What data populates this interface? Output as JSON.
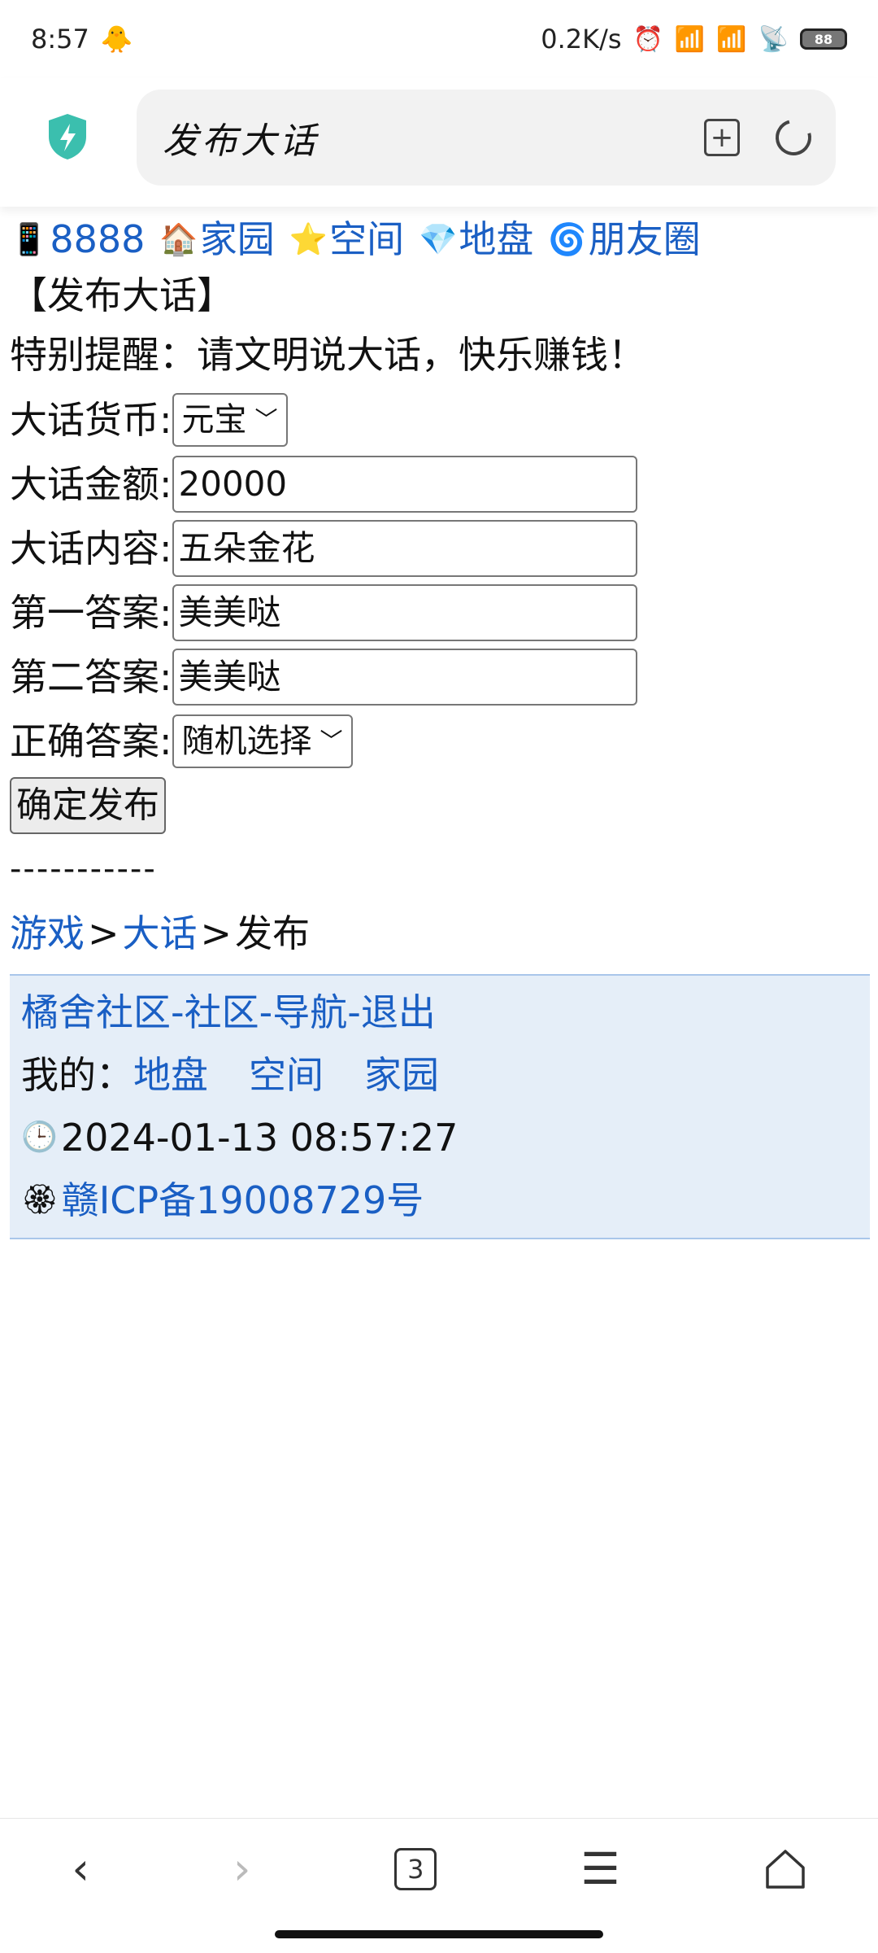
{
  "status_bar": {
    "time": "8:57",
    "network_speed": "0.2K/s",
    "battery": "88"
  },
  "browser": {
    "url_title": "发布大话"
  },
  "nav": {
    "items": [
      {
        "icon": "phone-icon",
        "label": "8888"
      },
      {
        "icon": "house-icon",
        "label": "家园"
      },
      {
        "icon": "star-icon",
        "label": "空间"
      },
      {
        "icon": "gem-icon",
        "label": "地盘"
      },
      {
        "icon": "aperture-icon",
        "label": "朋友圈"
      }
    ]
  },
  "page": {
    "heading": "【发布大话】",
    "notice": "特别提醒：请文明说大话，快乐赚钱！",
    "currency_label": "大话货币:",
    "currency_value": "元宝",
    "amount_label": "大话金额:",
    "amount_value": "20000",
    "content_label": "大话内容:",
    "content_value": "五朵金花",
    "answer1_label": "第一答案:",
    "answer1_value": "美美哒",
    "answer2_label": "第二答案:",
    "answer2_value": "美美哒",
    "correct_label": "正确答案:",
    "correct_value": "随机选择",
    "submit_label": "确定发布",
    "divider": "-----------"
  },
  "breadcrumb": {
    "game": "游戏",
    "sep1": ">",
    "dahua": "大话",
    "sep2": ">",
    "current": "发布"
  },
  "footer": {
    "site": "橘舍社区",
    "dash1": "-",
    "community": "社区",
    "dash2": "-",
    "navigation": "导航",
    "dash3": "-",
    "logout": "退出",
    "mine_label": "我的：",
    "mine_dipan": "地盘",
    "mine_space": "空间",
    "mine_home": "家园",
    "datetime": "2024-01-13 08:57:27",
    "icp": "赣ICP备19008729号"
  },
  "bottom_nav": {
    "tab_count": "3"
  }
}
